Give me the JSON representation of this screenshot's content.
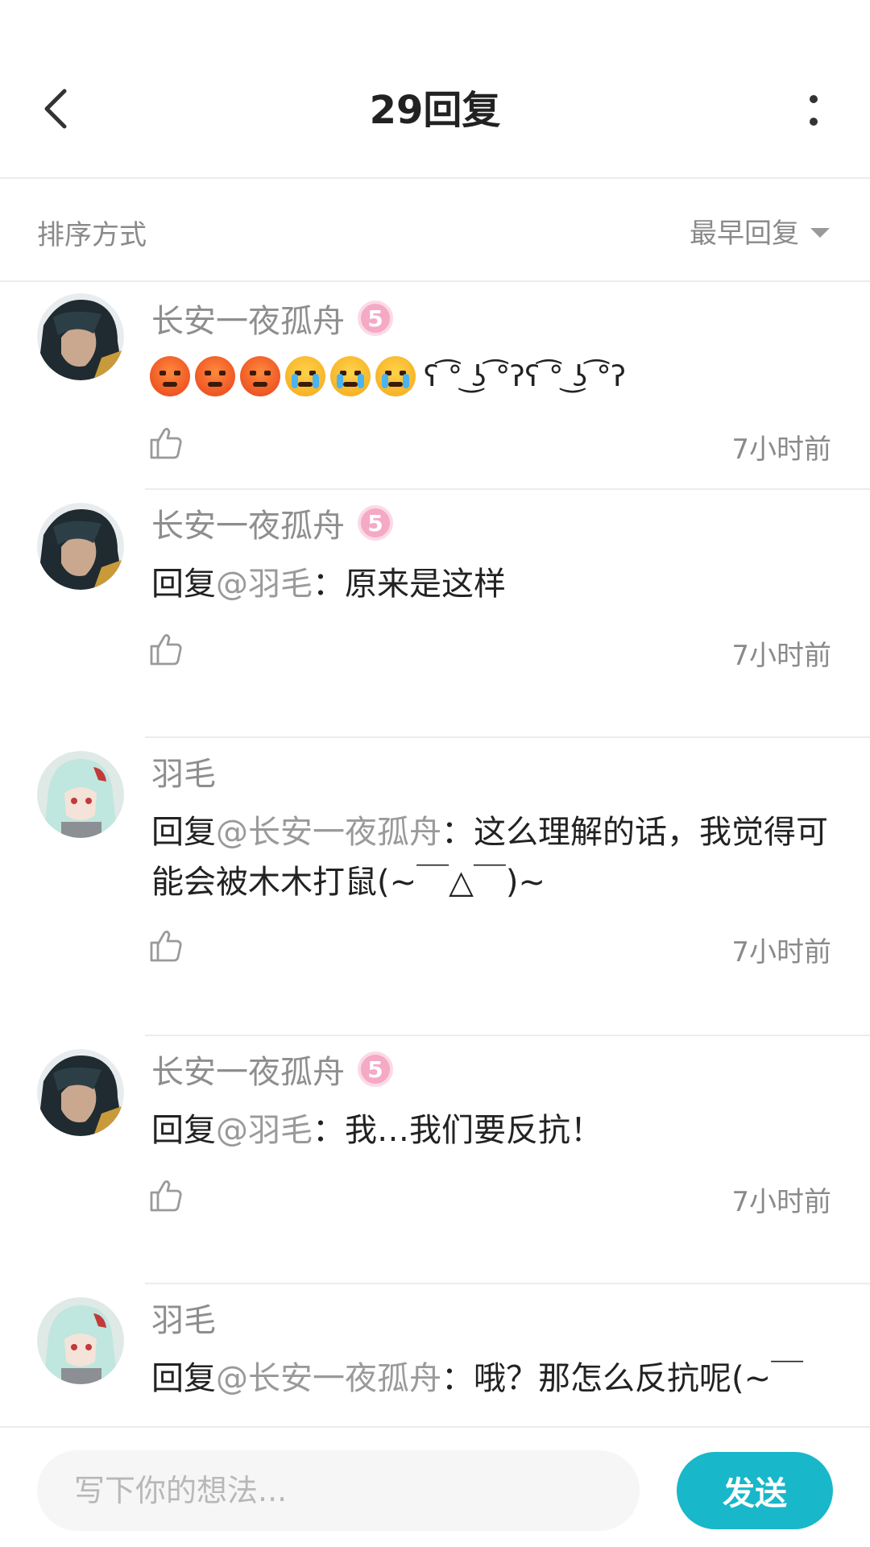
{
  "header": {
    "title": "29回复",
    "back_icon": "chevron-left-icon",
    "more_icon": "more-vertical-icon"
  },
  "sort": {
    "label": "排序方式",
    "value": "最早回复"
  },
  "colors": {
    "accent": "#18b7c9",
    "muted_text": "#8e8e8e",
    "badge_pink": "#f4a9c4"
  },
  "comments": [
    {
      "user": "长安一夜孤舟",
      "level": "5",
      "emoji_text": "😡😡😡😭😭😭",
      "lenny": "ʕ ͡° ͜ʖ ͡°ʔʕ ͡° ͜ʖ ͡°ʔ",
      "time": "7小时前"
    },
    {
      "user": "长安一夜孤舟",
      "level": "5",
      "prefix": "回复",
      "mention": "@羽毛",
      "body": "：原来是这样",
      "time": "7小时前"
    },
    {
      "user": "羽毛",
      "prefix": "回复",
      "mention": "@长安一夜孤舟",
      "body": "：这么理解的话，我觉得可能会被木木打鼠(~￣△￣)~",
      "time": "7小时前"
    },
    {
      "user": "长安一夜孤舟",
      "level": "5",
      "prefix": "回复",
      "mention": "@羽毛",
      "body": "：我…我们要反抗！",
      "time": "7小时前"
    },
    {
      "user": "羽毛",
      "prefix": "回复",
      "mention": "@长安一夜孤舟",
      "body": "：哦？那怎么反抗呢(~￣",
      "time": ""
    }
  ],
  "input": {
    "placeholder": "写下你的想法...",
    "value": ""
  },
  "send": {
    "label": "发送"
  }
}
